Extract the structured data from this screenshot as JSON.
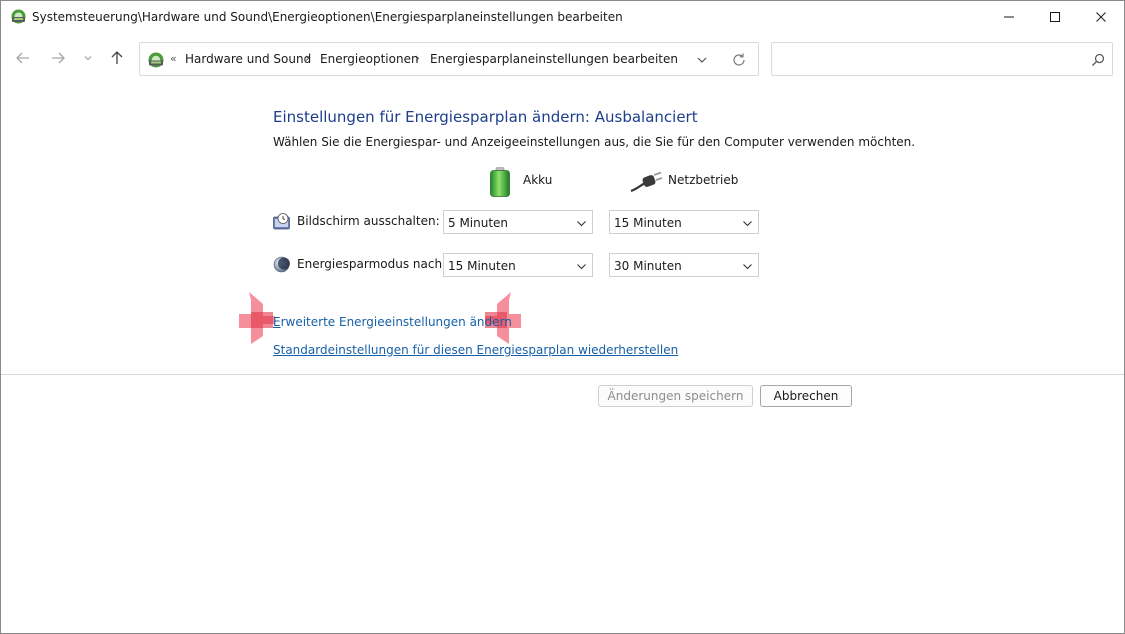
{
  "window": {
    "title": "Systemsteuerung\\Hardware und Sound\\Energieoptionen\\Energiesparplaneinstellungen bearbeiten"
  },
  "address": {
    "overflow": "«",
    "crumbs": [
      "Hardware und Sound",
      "Energieoptionen",
      "Energiesparplaneinstellungen bearbeiten"
    ],
    "separator": "›"
  },
  "search": {
    "value": "",
    "placeholder": ""
  },
  "page": {
    "heading": "Einstellungen für Energiesparplan ändern: Ausbalanciert",
    "description": "Wählen Sie die Energiespar- und Anzeigeeinstellungen aus, die Sie für den Computer verwenden möchten.",
    "columns": {
      "battery": "Akku",
      "plugged": "Netzbetrieb"
    },
    "rows": [
      {
        "label": "Bildschirm ausschalten:",
        "battery": "5 Minuten",
        "plugged": "15 Minuten"
      },
      {
        "label": "Energiesparmodus nach:",
        "battery": "15 Minuten",
        "plugged": "30 Minuten"
      }
    ],
    "links": {
      "advanced_first": "E",
      "advanced_rest": "rweiterte Energieeinstellungen ändern",
      "restore": "Standardeinstellungen für diesen Energiesparplan wiederherstellen"
    },
    "buttons": {
      "save": "Änderungen speichern",
      "cancel": "Abbrechen"
    }
  },
  "colors": {
    "heading": "#1e3e8c",
    "link": "#1760a8",
    "marker": "#f06070"
  },
  "icons": {
    "app": "control-panel-icon",
    "battery": "battery-icon",
    "plug": "power-plug-icon",
    "screen": "monitor-clock-icon",
    "sleep": "moon-icon"
  }
}
